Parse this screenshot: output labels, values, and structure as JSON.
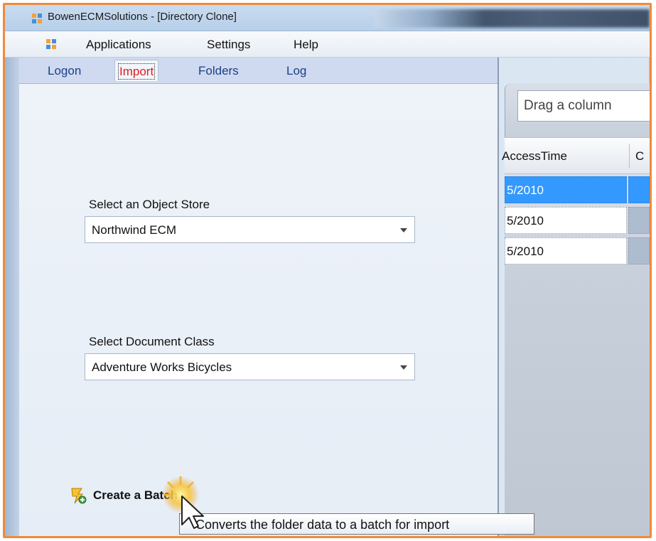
{
  "window": {
    "title": "BowenECMSolutions - [Directory Clone]"
  },
  "menu": {
    "items": [
      {
        "label": "Applications"
      },
      {
        "label": "Settings"
      },
      {
        "label": "Help"
      }
    ]
  },
  "tabs": [
    {
      "label": "Logon",
      "active": false
    },
    {
      "label": "Import",
      "active": true
    },
    {
      "label": "Folders",
      "active": false
    },
    {
      "label": "Log",
      "active": false
    }
  ],
  "import_form": {
    "object_store_label": "Select an Object Store",
    "object_store_value": "Northwind ECM",
    "document_class_label": "Select Document Class",
    "document_class_value": "Adventure Works Bicycles",
    "create_batch_label": "Create a Batch",
    "create_batch_tooltip": "Converts the folder data to a batch for import"
  },
  "grid": {
    "group_placeholder": "Drag a column",
    "columns": [
      "AccessTime",
      "C"
    ],
    "rows": [
      {
        "access_time": "5/2010",
        "selected": true
      },
      {
        "access_time": "5/2010",
        "selected": false
      },
      {
        "access_time": "5/2010",
        "selected": false
      }
    ]
  },
  "colors": {
    "frame_border": "#f08a3c",
    "active_tab_text": "#e11b1b",
    "tab_text": "#1b3f86",
    "selection": "#3399ff"
  },
  "icons": {
    "app_icon": "app-icon",
    "create_batch_icon": "lightning-add-icon",
    "cursor": "mouse-pointer-icon"
  }
}
